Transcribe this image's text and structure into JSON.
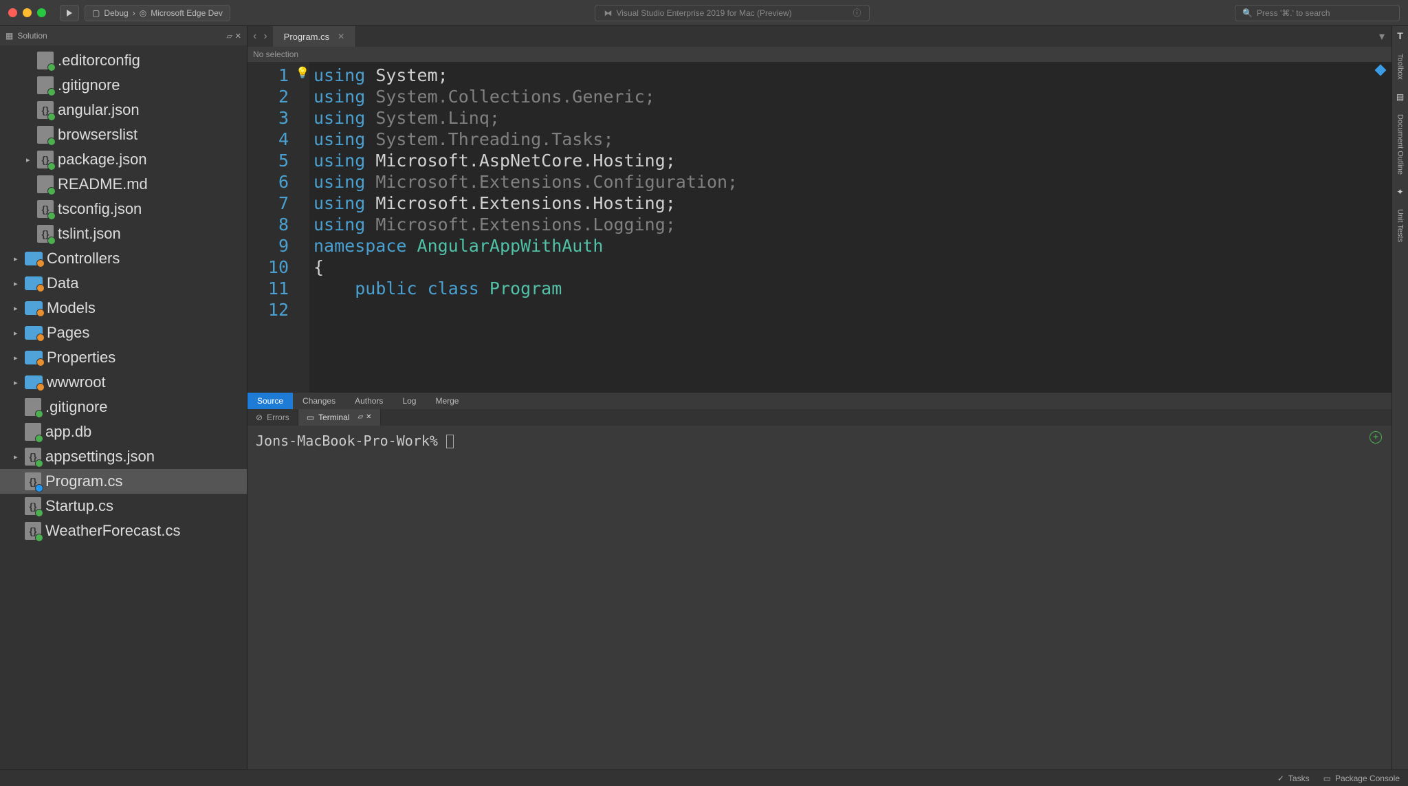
{
  "titlebar": {
    "config_label": "Debug",
    "target_label": "Microsoft Edge Dev",
    "app_title": "Visual Studio Enterprise 2019 for Mac (Preview)",
    "search_placeholder": "Press '⌘.' to search"
  },
  "solution": {
    "header": "Solution",
    "items": [
      {
        "name": ".editorconfig",
        "icon": "file",
        "badge": "green",
        "caret": ""
      },
      {
        "name": ".gitignore",
        "icon": "file",
        "badge": "green",
        "caret": ""
      },
      {
        "name": "angular.json",
        "icon": "json",
        "badge": "green",
        "caret": ""
      },
      {
        "name": "browserslist",
        "icon": "file",
        "badge": "green",
        "caret": ""
      },
      {
        "name": "package.json",
        "icon": "json",
        "badge": "green",
        "caret": "▸"
      },
      {
        "name": "README.md",
        "icon": "file",
        "badge": "green",
        "caret": ""
      },
      {
        "name": "tsconfig.json",
        "icon": "json",
        "badge": "green",
        "caret": ""
      },
      {
        "name": "tslint.json",
        "icon": "json",
        "badge": "green",
        "caret": ""
      },
      {
        "name": "Controllers",
        "icon": "folder",
        "badge": "orange",
        "caret": "▸"
      },
      {
        "name": "Data",
        "icon": "folder",
        "badge": "orange",
        "caret": "▸"
      },
      {
        "name": "Models",
        "icon": "folder",
        "badge": "orange",
        "caret": "▸"
      },
      {
        "name": "Pages",
        "icon": "folder",
        "badge": "orange",
        "caret": "▸"
      },
      {
        "name": "Properties",
        "icon": "folder",
        "badge": "orange",
        "caret": "▸"
      },
      {
        "name": "wwwroot",
        "icon": "folder",
        "badge": "orange",
        "caret": "▸"
      },
      {
        "name": ".gitignore",
        "icon": "file",
        "badge": "green",
        "caret": ""
      },
      {
        "name": "app.db",
        "icon": "file",
        "badge": "green",
        "caret": ""
      },
      {
        "name": "appsettings.json",
        "icon": "json",
        "badge": "green",
        "caret": "▸"
      },
      {
        "name": "Program.cs",
        "icon": "cs",
        "badge": "blue",
        "caret": "",
        "selected": true
      },
      {
        "name": "Startup.cs",
        "icon": "cs",
        "badge": "green",
        "caret": ""
      },
      {
        "name": "WeatherForecast.cs",
        "icon": "cs",
        "badge": "green",
        "caret": ""
      }
    ]
  },
  "editor": {
    "tab_name": "Program.cs",
    "breadcrumb": "No selection",
    "lines": [
      {
        "n": 1,
        "tokens": [
          [
            "kw",
            "using"
          ],
          [
            "plain",
            " System;"
          ]
        ]
      },
      {
        "n": 2,
        "tokens": [
          [
            "kw",
            "using"
          ],
          [
            "dim",
            " System.Collections.Generic;"
          ]
        ]
      },
      {
        "n": 3,
        "tokens": [
          [
            "kw",
            "using"
          ],
          [
            "dim",
            " System.Linq;"
          ]
        ]
      },
      {
        "n": 4,
        "tokens": [
          [
            "kw",
            "using"
          ],
          [
            "dim",
            " System.Threading.Tasks;"
          ]
        ]
      },
      {
        "n": 5,
        "tokens": [
          [
            "kw",
            "using"
          ],
          [
            "plain",
            " Microsoft.AspNetCore.Hosting;"
          ]
        ]
      },
      {
        "n": 6,
        "tokens": [
          [
            "kw",
            "using"
          ],
          [
            "dim",
            " Microsoft.Extensions.Configuration;"
          ]
        ]
      },
      {
        "n": 7,
        "tokens": [
          [
            "kw",
            "using"
          ],
          [
            "plain",
            " Microsoft.Extensions.Hosting;"
          ]
        ]
      },
      {
        "n": 8,
        "tokens": [
          [
            "kw",
            "using"
          ],
          [
            "dim",
            " Microsoft.Extensions.Logging;"
          ]
        ]
      },
      {
        "n": 9,
        "tokens": [
          [
            "plain",
            ""
          ]
        ]
      },
      {
        "n": 10,
        "tokens": [
          [
            "kw",
            "namespace"
          ],
          [
            "plain",
            " "
          ],
          [
            "type",
            "AngularAppWithAuth"
          ]
        ]
      },
      {
        "n": 11,
        "tokens": [
          [
            "plain",
            "{"
          ]
        ]
      },
      {
        "n": 12,
        "tokens": [
          [
            "plain",
            "    "
          ],
          [
            "kw",
            "public"
          ],
          [
            "plain",
            " "
          ],
          [
            "kw",
            "class"
          ],
          [
            "plain",
            " "
          ],
          [
            "type",
            "Program"
          ]
        ]
      }
    ]
  },
  "sourceTabs": [
    "Source",
    "Changes",
    "Authors",
    "Log",
    "Merge"
  ],
  "bottomTabs": {
    "errors": "Errors",
    "terminal": "Terminal"
  },
  "terminal": {
    "prompt": "Jons-MacBook-Pro-Work% "
  },
  "rightStrip": {
    "toolbox": "Toolbox",
    "doc_outline": "Document Outline",
    "unit_tests": "Unit Tests"
  },
  "statusbar": {
    "tasks": "Tasks",
    "package_console": "Package Console"
  }
}
